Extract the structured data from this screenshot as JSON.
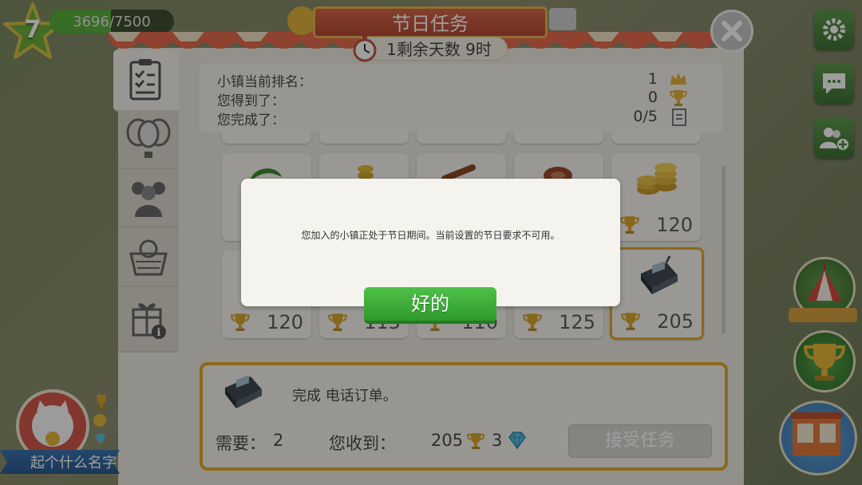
{
  "hud": {
    "level": "7",
    "xp_text": "3696/7500",
    "xp_fraction": 0.493
  },
  "header": {
    "title": "节日任务",
    "timer": "1剩余天数 9时"
  },
  "stats": {
    "rank_label": "小镇当前排名：",
    "rank_value": "1",
    "received_label": "您得到了：",
    "received_value": "0",
    "completed_label": "您完成了：",
    "completed_value": "0/5"
  },
  "task_cards": [
    {
      "trophies": ""
    },
    {
      "trophies": ""
    },
    {
      "trophies": ""
    },
    {
      "trophies": ""
    },
    {
      "trophies": "120"
    },
    {
      "trophies": "120"
    },
    {
      "trophies": "115"
    },
    {
      "trophies": "110"
    },
    {
      "trophies": "125"
    },
    {
      "trophies": "205"
    }
  ],
  "detail": {
    "task_text": "完成 电话订单。",
    "need_label": "需要：",
    "need_value": "2",
    "reward_label": "您收到：",
    "reward_trophies": "205",
    "reward_diamonds": "3",
    "accept_button": "接受任务"
  },
  "profile": {
    "name": "起个什么名字"
  },
  "modal": {
    "message": "您加入的小镇正处于节日期间。当前设置的节日要求不可用。",
    "ok_button": "好的"
  },
  "icons": [
    "star-icon",
    "gear-icon",
    "chat-icon",
    "add-friend-icon",
    "checklist-icon",
    "balloons-icon",
    "people-icon",
    "basket-icon",
    "gift-info-icon",
    "trophy-icon",
    "diamond-icon",
    "phone-icon",
    "close-icon",
    "circus-tent-icon",
    "stopwatch-icon"
  ],
  "colors": {
    "accent_green": "#3aa536",
    "gold": "#e2a92a",
    "banner_red": "#c4553d"
  }
}
